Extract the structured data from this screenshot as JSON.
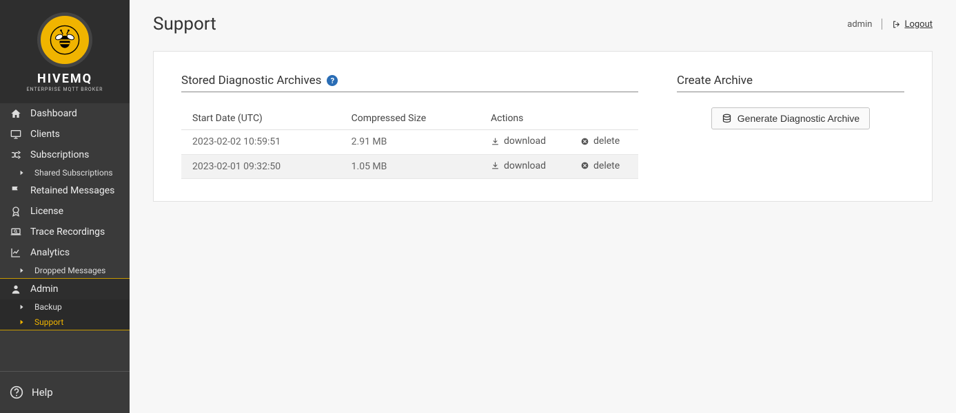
{
  "branding": {
    "name": "HIVEMQ",
    "tagline": "ENTERPRISE MQTT BROKER"
  },
  "sidebar": {
    "items": [
      {
        "label": "Dashboard"
      },
      {
        "label": "Clients"
      },
      {
        "label": "Subscriptions"
      },
      {
        "label": "Retained Messages"
      },
      {
        "label": "License"
      },
      {
        "label": "Trace Recordings"
      },
      {
        "label": "Analytics"
      }
    ],
    "sub_shared": "Shared Subscriptions",
    "sub_dropped": "Dropped Messages",
    "admin": {
      "label": "Admin",
      "backup": "Backup",
      "support": "Support"
    },
    "help": "Help"
  },
  "header": {
    "title": "Support",
    "user": "admin",
    "logout": "Logout"
  },
  "archives": {
    "title": "Stored Diagnostic Archives",
    "columns": {
      "date": "Start Date (UTC)",
      "size": "Compressed Size",
      "actions": "Actions"
    },
    "rows": [
      {
        "date": "2023-02-02 10:59:51",
        "size": "2.91 MB"
      },
      {
        "date": "2023-02-01 09:32:50",
        "size": "1.05 MB"
      }
    ],
    "download_label": "download",
    "delete_label": "delete"
  },
  "create": {
    "title": "Create Archive",
    "button": "Generate Diagnostic Archive"
  }
}
